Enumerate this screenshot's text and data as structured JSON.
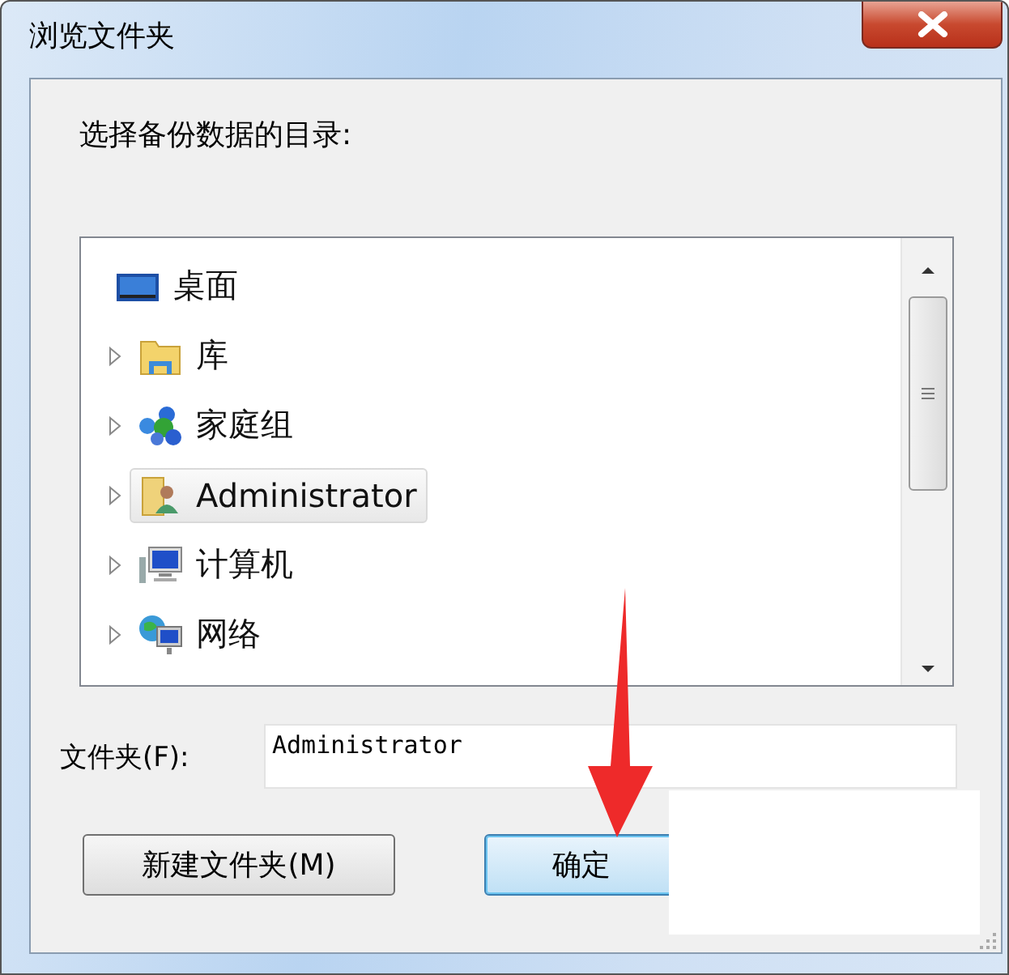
{
  "window": {
    "title": "浏览文件夹"
  },
  "prompt": "选择备份数据的目录:",
  "tree": {
    "items": [
      {
        "label": "桌面",
        "kind": "desktop",
        "expandable": false,
        "selected": false
      },
      {
        "label": "库",
        "kind": "library",
        "expandable": true,
        "selected": false
      },
      {
        "label": "家庭组",
        "kind": "homegroup",
        "expandable": true,
        "selected": false
      },
      {
        "label": "Administrator",
        "kind": "user",
        "expandable": true,
        "selected": true
      },
      {
        "label": "计算机",
        "kind": "computer",
        "expandable": true,
        "selected": false
      },
      {
        "label": "网络",
        "kind": "network",
        "expandable": true,
        "selected": false
      }
    ]
  },
  "folder_field": {
    "label": "文件夹(F):",
    "value": "Administrator"
  },
  "buttons": [
    {
      "label": "新建文件夹(M)",
      "default": false
    },
    {
      "label": "确定",
      "default": true
    }
  ]
}
